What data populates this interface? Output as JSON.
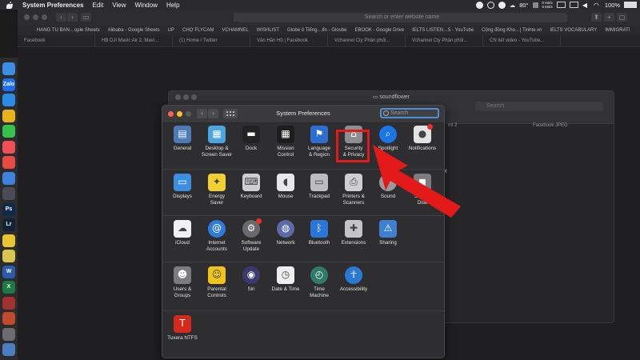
{
  "menubar": {
    "app_name": "System Preferences",
    "menus": [
      "Edit",
      "View",
      "Window",
      "Help"
    ],
    "status": {
      "temperature": "80°",
      "net_up": "0 KB/s",
      "net_down": "0 KB/s",
      "battery": "100%"
    }
  },
  "browser": {
    "url_placeholder": "Search or enter website name",
    "bookmarks": [
      "HANG TU BAN…ople Sheets",
      "Alibaba - Google Sheets",
      "UP",
      "CHỢ FLYCAM",
      "VCHAMNEL",
      "WISHLIST",
      "Globe ô Tiếng…ển - Glosbe",
      "EBOOK - Google Drive",
      "IELTS LISTEN…5 - YouTube",
      "Cộng đồng Kho…| Tinhte.vn",
      "IELTS VOCABULARY",
      "IMMIGRATI"
    ],
    "tabs": [
      "Facebook",
      "HB DJI Mavic Air 2, Mavi...",
      "(1) Home / Twitter",
      "Văn Hân Hồ | Facebook",
      "Vchannel Cty Phân phối...",
      "Vchannel Cty Phân phối...",
      "CN tiết video - YouTube..."
    ]
  },
  "dock": {
    "items": [
      {
        "name": "finder-icon",
        "label": "",
        "color": "#3a8ee6"
      },
      {
        "name": "zalo-icon",
        "label": "Zalo",
        "color": "#1d6ff2"
      },
      {
        "name": "safari-icon",
        "label": "",
        "color": "#2b8be8"
      },
      {
        "name": "chrome-icon",
        "label": "",
        "color": "#e8b21c"
      },
      {
        "name": "messages-icon",
        "label": "",
        "color": "#36c24a"
      },
      {
        "name": "music-icon",
        "label": "",
        "color": "#f04f57"
      },
      {
        "name": "calendar-icon",
        "label": "",
        "color": "#e94a3f"
      },
      {
        "name": "mail-icon",
        "label": "",
        "color": "#3d82e0"
      },
      {
        "name": "final-cut-icon",
        "label": "",
        "color": "#4b4b55"
      },
      {
        "name": "photoshop-icon",
        "label": "Ps",
        "color": "#0e2a4a"
      },
      {
        "name": "lightroom-icon",
        "label": "Lr",
        "color": "#0f2338"
      },
      {
        "name": "notes-icon",
        "label": "",
        "color": "#e8c531"
      },
      {
        "name": "stickies-icon",
        "label": "",
        "color": "#d9c64e"
      },
      {
        "name": "word-icon",
        "label": "W",
        "color": "#2b5aab"
      },
      {
        "name": "excel-icon",
        "label": "X",
        "color": "#1d7a43"
      },
      {
        "name": "access-icon",
        "label": "",
        "color": "#a43131"
      },
      {
        "name": "powerpoint-icon",
        "label": "",
        "color": "#c24a2c"
      },
      {
        "name": "system-preferences-dock-icon",
        "label": "",
        "color": "#6b6b70"
      },
      {
        "name": "downloads-icon",
        "label": "",
        "color": "#4a7fc1"
      }
    ]
  },
  "finder": {
    "title": "soundflower",
    "search_placeholder": "Search",
    "columns": [
      "ml 2",
      "Facebook JPEG"
    ],
    "fragment": "pt"
  },
  "syspref": {
    "title": "System Preferences",
    "search_placeholder": "Search",
    "sections": [
      [
        {
          "name": "general",
          "label": "General",
          "icon_color": "#4a7ab8"
        },
        {
          "name": "desktop-screen-saver",
          "label": "Desktop &\nScreen Saver",
          "icon_color": "#4aa5e0"
        },
        {
          "name": "dock",
          "label": "Dock",
          "icon_color": "#222"
        },
        {
          "name": "mission-control",
          "label": "Mission\nControl",
          "icon_color": "#1d1d1d"
        },
        {
          "name": "language-region",
          "label": "Language\n& Region",
          "icon_color": "#2d6fd1"
        },
        {
          "name": "security-privacy",
          "label": "Security\n& Privacy",
          "icon_color": "#8e8e92"
        },
        {
          "name": "spotlight",
          "label": "Spotlight",
          "icon_color": "#1c76e8"
        },
        {
          "name": "notifications",
          "label": "Notifications",
          "icon_color": "#e3e3e3"
        }
      ],
      [
        {
          "name": "displays",
          "label": "Displays",
          "icon_color": "#3b8ee0"
        },
        {
          "name": "energy-saver",
          "label": "Energy\nSaver",
          "icon_color": "#f1d033"
        },
        {
          "name": "keyboard",
          "label": "Keyboard",
          "icon_color": "#cfcfd2"
        },
        {
          "name": "mouse",
          "label": "Mouse",
          "icon_color": "#e8e8ea"
        },
        {
          "name": "trackpad",
          "label": "Trackpad",
          "icon_color": "#bdbdc0"
        },
        {
          "name": "printers-scanners",
          "label": "Printers &\nScanners",
          "icon_color": "#cfcfd3"
        },
        {
          "name": "sound",
          "label": "Sound",
          "icon_color": "#9a9a9e"
        },
        {
          "name": "startup-disk",
          "label": "Startup\nDisk",
          "icon_color": "#7d7d80"
        }
      ],
      [
        {
          "name": "icloud",
          "label": "iCloud",
          "icon_color": "#f2f2f4"
        },
        {
          "name": "internet-accounts",
          "label": "Internet\nAccounts",
          "icon_color": "#2f7bdc"
        },
        {
          "name": "software-update",
          "label": "Software\nUpdate",
          "icon_color": "#6a6a6e"
        },
        {
          "name": "network",
          "label": "Network",
          "icon_color": "#5c6aa8"
        },
        {
          "name": "bluetooth",
          "label": "Bluetooth",
          "icon_color": "#2b75d8"
        },
        {
          "name": "extensions",
          "label": "Extensions",
          "icon_color": "#c4c4c6"
        },
        {
          "name": "sharing",
          "label": "Sharing",
          "icon_color": "#3f7fd0"
        }
      ],
      [
        {
          "name": "users-groups",
          "label": "Users &\nGroups",
          "icon_color": "#7c7c80"
        },
        {
          "name": "parental-controls",
          "label": "Parental\nControls",
          "icon_color": "#f0c419"
        },
        {
          "name": "siri",
          "label": "Siri",
          "icon_color": "#3a3a70"
        },
        {
          "name": "date-time",
          "label": "Date & Time",
          "icon_color": "#efefef"
        },
        {
          "name": "time-machine",
          "label": "Time\nMachine",
          "icon_color": "#2f7b6a"
        },
        {
          "name": "accessibility",
          "label": "Accessibility",
          "icon_color": "#2b79d6"
        }
      ],
      [
        {
          "name": "tuxera-ntfs",
          "label": "Tuxera NTFS",
          "icon_color": "#d5291c"
        }
      ]
    ]
  }
}
